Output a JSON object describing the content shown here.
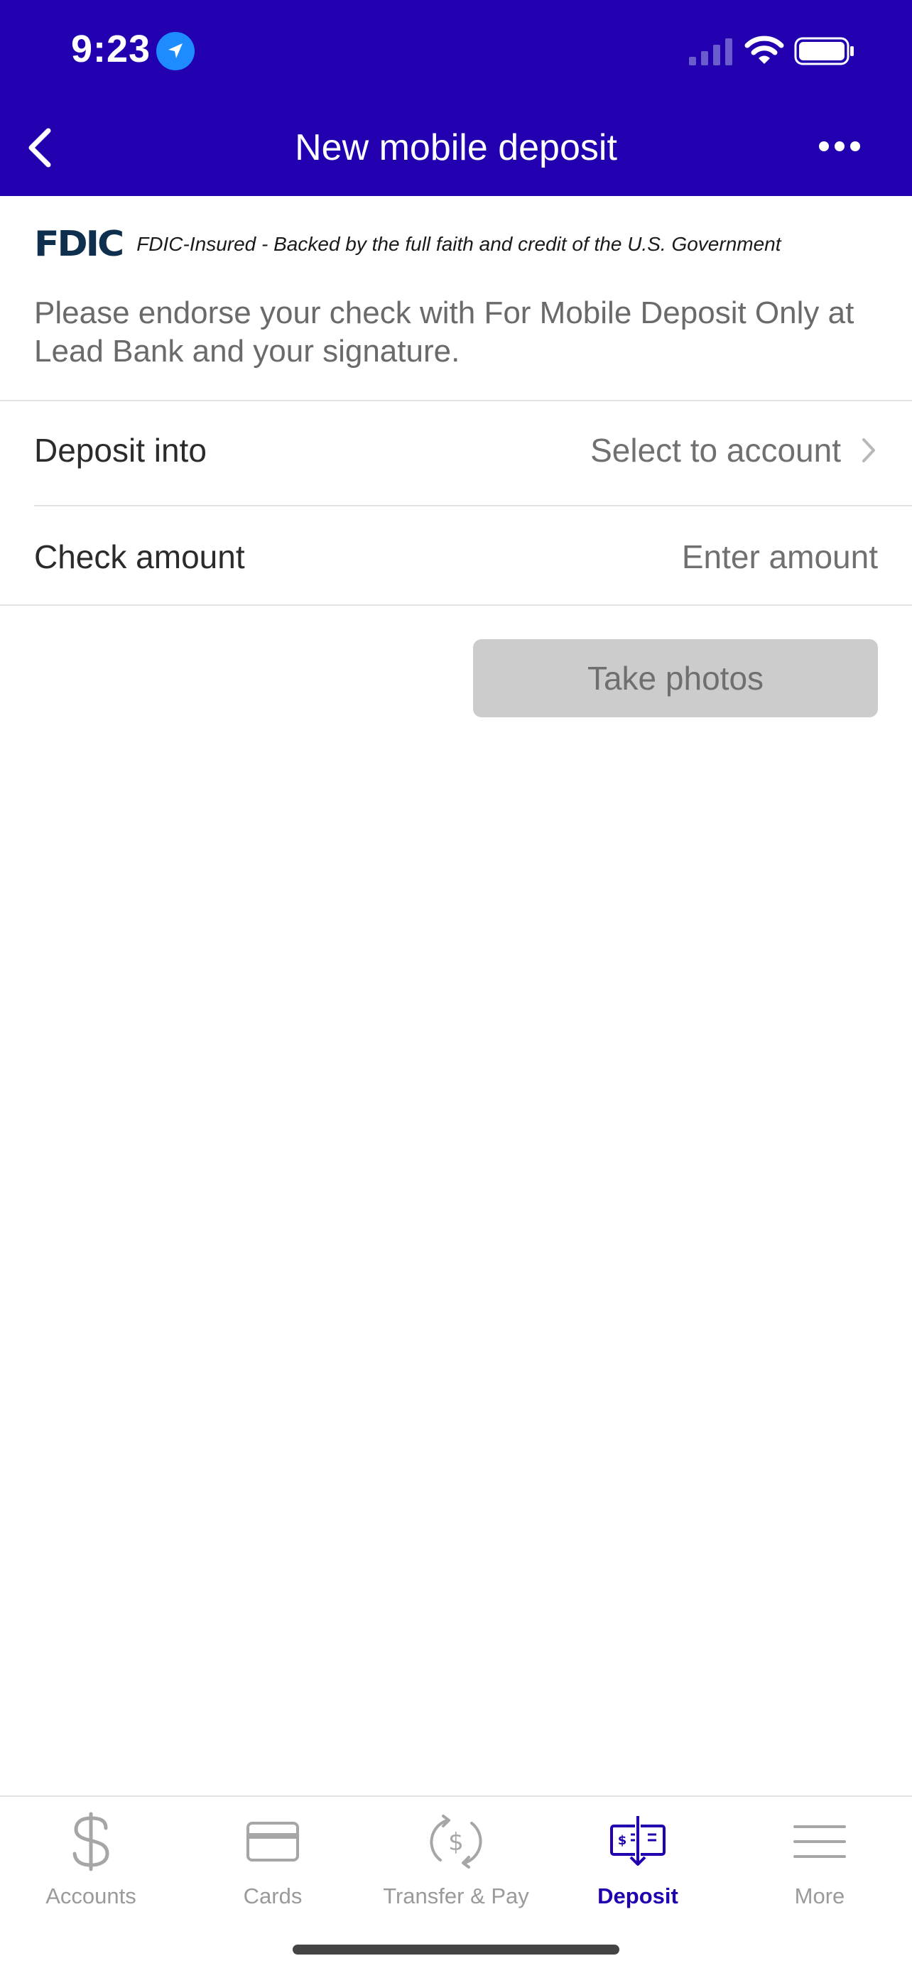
{
  "status_bar": {
    "time": "9:23",
    "location_icon": "location-arrow-icon",
    "signal_icon": "cellular-signal-icon",
    "wifi_icon": "wifi-icon",
    "battery_icon": "battery-icon"
  },
  "nav": {
    "title": "New mobile deposit",
    "back_icon": "chevron-left-icon",
    "more_icon": "ellipsis-icon"
  },
  "fdic": {
    "logo": "FDIC",
    "text": "FDIC-Insured - Backed by the full faith and credit of the U.S. Government"
  },
  "instructions": "Please endorse your check with For Mobile Deposit Only at Lead Bank and your signature.",
  "form": {
    "deposit_into": {
      "label": "Deposit into",
      "value": "Select to account"
    },
    "check_amount": {
      "label": "Check amount",
      "placeholder": "Enter amount"
    }
  },
  "take_photos_label": "Take photos",
  "tabs": [
    {
      "label": "Accounts",
      "icon": "dollar-icon"
    },
    {
      "label": "Cards",
      "icon": "card-icon"
    },
    {
      "label": "Transfer & Pay",
      "icon": "transfer-icon"
    },
    {
      "label": "Deposit",
      "icon": "check-deposit-icon",
      "active": true
    },
    {
      "label": "More",
      "icon": "menu-icon"
    }
  ],
  "colors": {
    "brand": "#2200b0",
    "location_badge": "#1e8cff",
    "button_disabled": "#cccccc",
    "fdic_logo": "#0f2f4f"
  }
}
